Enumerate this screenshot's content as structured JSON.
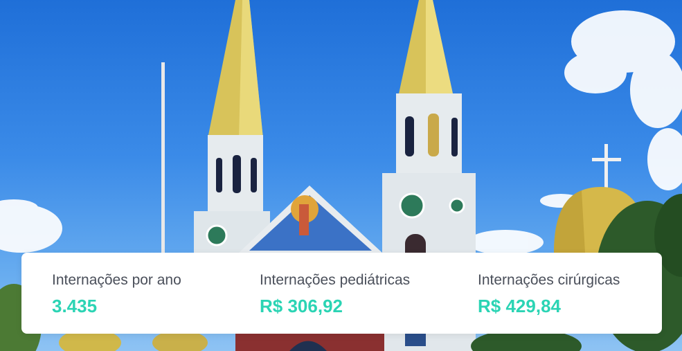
{
  "stats": [
    {
      "label": "Internações por ano",
      "value": "3.435"
    },
    {
      "label": "Internações pediátricas",
      "value": "R$ 306,92"
    },
    {
      "label": "Internações cirúrgicas",
      "value": "R$ 429,84"
    }
  ],
  "colors": {
    "value": "#2bd4b4",
    "label": "#4a4f5a",
    "card": "#ffffff",
    "sky": "#3b8be8"
  }
}
